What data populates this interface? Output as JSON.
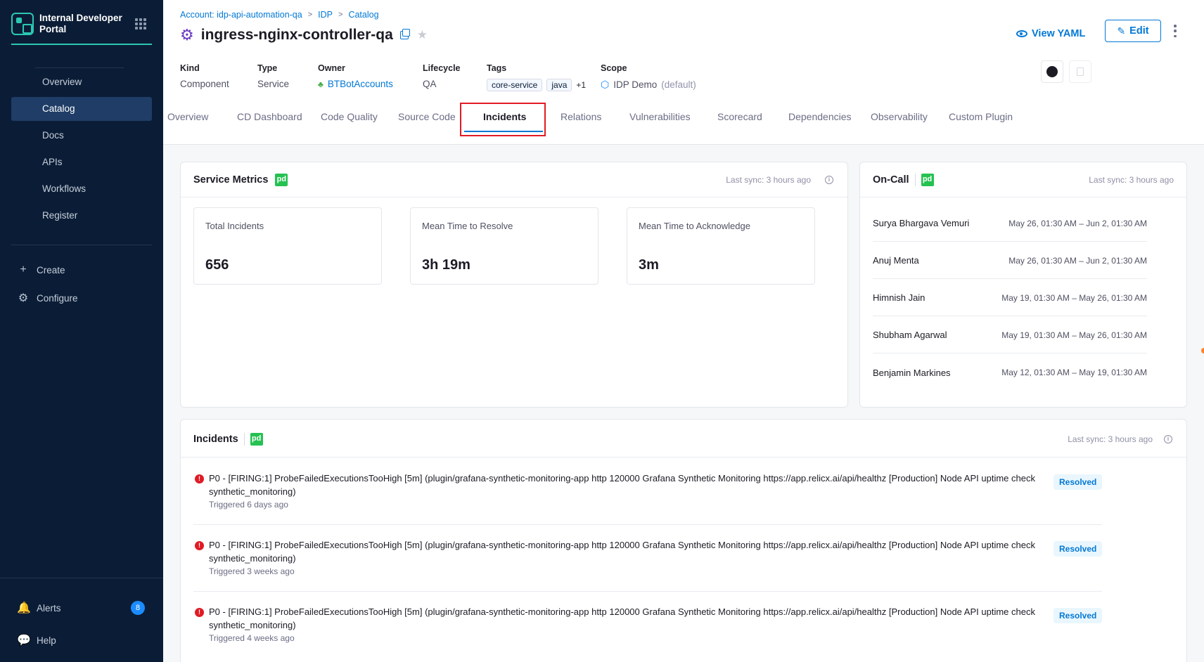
{
  "sidebar": {
    "brand_name": "Internal Developer Portal",
    "nav": [
      {
        "label": "Overview",
        "active": false
      },
      {
        "label": "Catalog",
        "active": true
      },
      {
        "label": "Docs",
        "active": false
      },
      {
        "label": "APIs",
        "active": false
      },
      {
        "label": "Workflows",
        "active": false
      },
      {
        "label": "Register",
        "active": false
      }
    ],
    "create_label": "Create",
    "configure_label": "Configure",
    "alerts_label": "Alerts",
    "alerts_count": "8",
    "help_label": "Help"
  },
  "header": {
    "breadcrumb": [
      "Account: idp-api-automation-qa",
      "IDP",
      "Catalog"
    ],
    "title": "ingress-nginx-controller-qa",
    "view_yaml_label": "View YAML",
    "edit_label": "Edit",
    "meta": {
      "kind_label": "Kind",
      "kind_value": "Component",
      "type_label": "Type",
      "type_value": "Service",
      "owner_label": "Owner",
      "owner_value": "BTBotAccounts",
      "lifecycle_label": "Lifecycle",
      "lifecycle_value": "QA",
      "tags_label": "Tags",
      "tags": [
        "core-service",
        "java"
      ],
      "tags_more": "+1",
      "scope_label": "Scope",
      "scope_value": "IDP Demo",
      "scope_suffix": "(default)"
    }
  },
  "tabs": [
    {
      "label": "Overview"
    },
    {
      "label": "CD Dashboard"
    },
    {
      "label": "Code Quality"
    },
    {
      "label": "Source Code"
    },
    {
      "label": "Incidents",
      "active": true
    },
    {
      "label": "Relations"
    },
    {
      "label": "Vulnerabilities"
    },
    {
      "label": "Scorecard"
    },
    {
      "label": "Dependencies"
    },
    {
      "label": "Observability"
    },
    {
      "label": "Custom Plugin"
    }
  ],
  "service_metrics": {
    "title": "Service Metrics",
    "last_sync": "Last sync: 3 hours ago",
    "metrics": [
      {
        "label": "Total Incidents",
        "value": "656"
      },
      {
        "label": "Mean Time to Resolve",
        "value": "3h 19m"
      },
      {
        "label": "Mean Time to Acknowledge",
        "value": "3m"
      }
    ]
  },
  "on_call": {
    "title": "On-Call",
    "last_sync": "Last sync: 3 hours ago",
    "people": [
      {
        "name": "Surya Bhargava Vemuri",
        "range": "May 26, 01:30 AM – Jun 2, 01:30 AM"
      },
      {
        "name": "Anuj Menta",
        "range": "May 26, 01:30 AM – Jun 2, 01:30 AM"
      },
      {
        "name": "Himnish Jain",
        "range": "May 19, 01:30 AM – May 26, 01:30 AM"
      },
      {
        "name": "Shubham Agarwal",
        "range": "May 19, 01:30 AM – May 26, 01:30 AM"
      },
      {
        "name": "Benjamin Markines",
        "range": "May 12, 01:30 AM – May 19, 01:30 AM"
      }
    ]
  },
  "incidents": {
    "title": "Incidents",
    "last_sync": "Last sync: 3 hours ago",
    "items": [
      {
        "title": "P0 - [FIRING:1] ProbeFailedExecutionsTooHigh [5m] (plugin/grafana-synthetic-monitoring-app http 120000 Grafana Synthetic Monitoring https://app.relicx.ai/api/healthz [Production] Node API uptime check synthetic_monitoring)",
        "triggered": "Triggered 6 days ago",
        "status": "Resolved"
      },
      {
        "title": "P0 - [FIRING:1] ProbeFailedExecutionsTooHigh [5m] (plugin/grafana-synthetic-monitoring-app http 120000 Grafana Synthetic Monitoring https://app.relicx.ai/api/healthz [Production] Node API uptime check synthetic_monitoring)",
        "triggered": "Triggered 3 weeks ago",
        "status": "Resolved"
      },
      {
        "title": "P0 - [FIRING:1] ProbeFailedExecutionsTooHigh [5m] (plugin/grafana-synthetic-monitoring-app http 120000 Grafana Synthetic Monitoring https://app.relicx.ai/api/healthz [Production] Node API uptime check synthetic_monitoring)",
        "triggered": "Triggered 4 weeks ago",
        "status": "Resolved"
      }
    ]
  },
  "pd_logo_text": "pd",
  "icons": {
    "gear": "gear-icon",
    "copy": "copy-icon",
    "star": "star-icon",
    "eye": "eye-icon",
    "pencil": "pencil-icon",
    "github": "github-icon",
    "bell": "bell-icon",
    "help": "help-icon"
  },
  "colors": {
    "sidebar_bg": "#0b1d36",
    "accent": "#0278d5",
    "brand_teal": "#2bc7b4",
    "pagerduty_green": "#25c151",
    "error_red": "#e01b24"
  }
}
